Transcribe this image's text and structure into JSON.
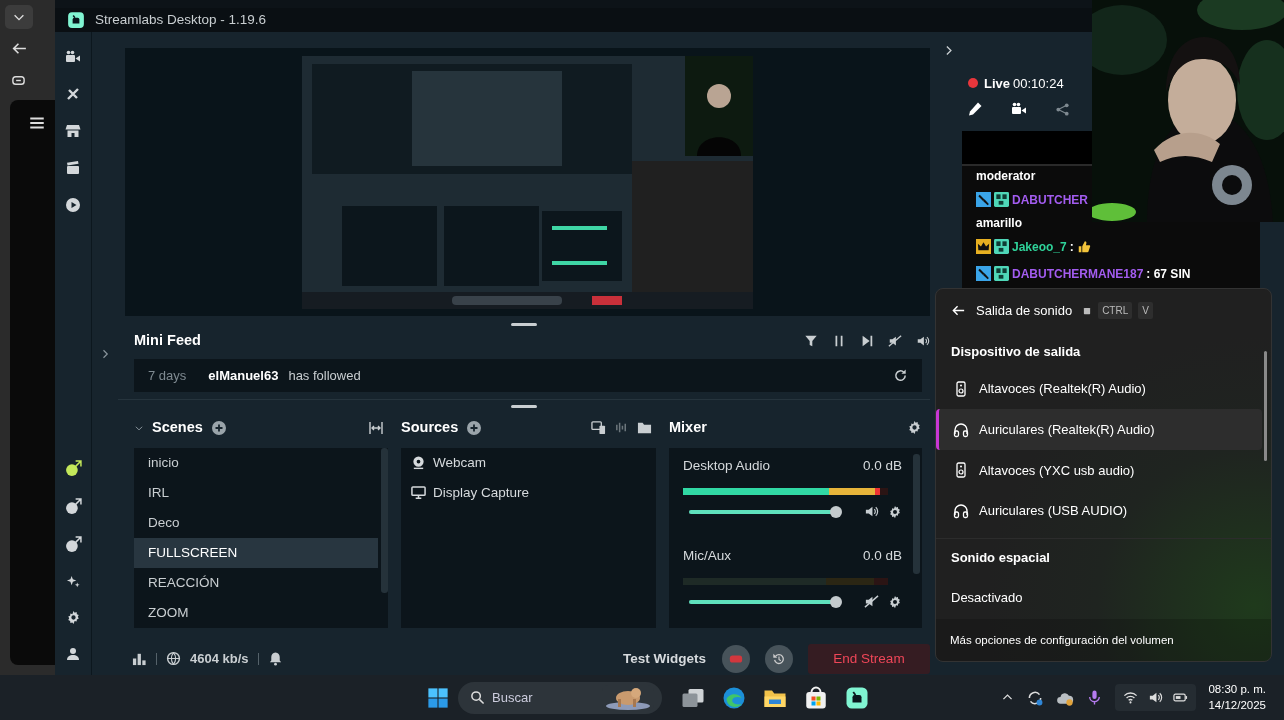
{
  "window": {
    "title": "Streamlabs Desktop - 1.19.6"
  },
  "mini_feed": {
    "title": "Mini Feed",
    "events": [
      {
        "time": "7 days",
        "user": "elManuel63",
        "action": "has followed"
      }
    ]
  },
  "scenes": {
    "title": "Scenes",
    "items": [
      {
        "label": "inicio",
        "selected": false
      },
      {
        "label": "IRL",
        "selected": false
      },
      {
        "label": "Deco",
        "selected": false
      },
      {
        "label": "FULLSCREEN",
        "selected": true
      },
      {
        "label": "REACCIÓN",
        "selected": false
      },
      {
        "label": "ZOOM",
        "selected": false
      }
    ]
  },
  "sources": {
    "title": "Sources",
    "items": [
      {
        "label": "Webcam",
        "kind": "webcam"
      },
      {
        "label": "Display Capture",
        "kind": "display"
      }
    ]
  },
  "mixer": {
    "title": "Mixer",
    "channels": [
      {
        "name": "Desktop Audio",
        "reading": "0.0 dB",
        "meter": {
          "level": 0.96
        },
        "volume": {
          "level": 0.97
        },
        "muted": false
      },
      {
        "name": "Mic/Aux",
        "reading": "0.0 dB",
        "meter": {
          "level": 0
        },
        "volume": {
          "level": 0.97
        },
        "muted": true
      }
    ]
  },
  "footer": {
    "bitrate": "4604 kb/s",
    "test_widgets": "Test Widgets",
    "end_stream": "End Stream"
  },
  "stream": {
    "status": "Live",
    "timer": "00:10:24"
  },
  "chat": {
    "messages": [
      {
        "kind": "note",
        "text": "moderator"
      },
      {
        "kind": "mod",
        "user": "DABUTCHER",
        "color": "#a35cf0"
      },
      {
        "kind": "note",
        "text": "amarillo"
      },
      {
        "kind": "vip",
        "user": "Jakeoo_7",
        "color": "#2fd39a",
        "text": ":"
      },
      {
        "kind": "mod",
        "user": "DABUTCHERMANE187",
        "color": "#a35cf0",
        "text": ": 67 SIN"
      }
    ]
  },
  "sound_flyout": {
    "title": "Salida de sonido",
    "shortcut": [
      "CTRL",
      "V"
    ],
    "output_heading": "Dispositivo de salida",
    "devices": [
      {
        "label": "Altavoces (Realtek(R) Audio)",
        "kind": "speaker",
        "selected": false
      },
      {
        "label": "Auriculares (Realtek(R) Audio)",
        "kind": "headphones",
        "selected": true
      },
      {
        "label": "Altavoces (YXC usb audio)",
        "kind": "speaker",
        "selected": false
      },
      {
        "label": "Auriculares (USB AUDIO)",
        "kind": "headphones",
        "selected": false
      }
    ],
    "spatial_heading": "Sonido espacial",
    "spatial_value": "Desactivado",
    "more_link": "Más opciones de configuración del volumen"
  },
  "taskbar": {
    "search": {
      "placeholder": "Buscar"
    },
    "time": "08:30 p. m.",
    "date": "14/12/2025"
  }
}
